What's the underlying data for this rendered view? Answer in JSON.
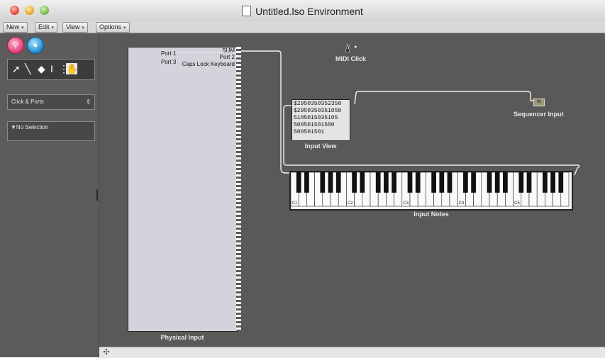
{
  "window": {
    "title": "Untitled.lso Environment"
  },
  "menus": [
    {
      "label": "New"
    },
    {
      "label": "Edit"
    },
    {
      "label": "View"
    },
    {
      "label": "Options"
    }
  ],
  "left_panel": {
    "layer_menu": "Click & Ports",
    "inspector_label": "▼No Selection"
  },
  "objects": {
    "physical_input": {
      "name": "Physical Input",
      "outputs": [
        "SUM",
        "Port 1",
        "Port 2",
        "Port 3",
        "Caps Lock Keyboard"
      ]
    },
    "midi_click": {
      "name": "MIDI Click"
    },
    "input_view": {
      "name": "Input View",
      "lines": [
        "$2950350352350",
        "$2950350351050",
        "5105015035105",
        "500501501500",
        "500501501"
      ]
    },
    "sequencer_input": {
      "name": "Sequencer Input",
      "badge": "IN"
    },
    "input_notes": {
      "name": "Input Notes",
      "octave_labels": [
        "C1",
        "C2",
        "C3",
        "C4",
        "C5"
      ]
    }
  },
  "colors": {
    "canvas_bg": "#5b5957",
    "panel_bg": "#5c5c5c",
    "wire": "#f0f0f0"
  }
}
